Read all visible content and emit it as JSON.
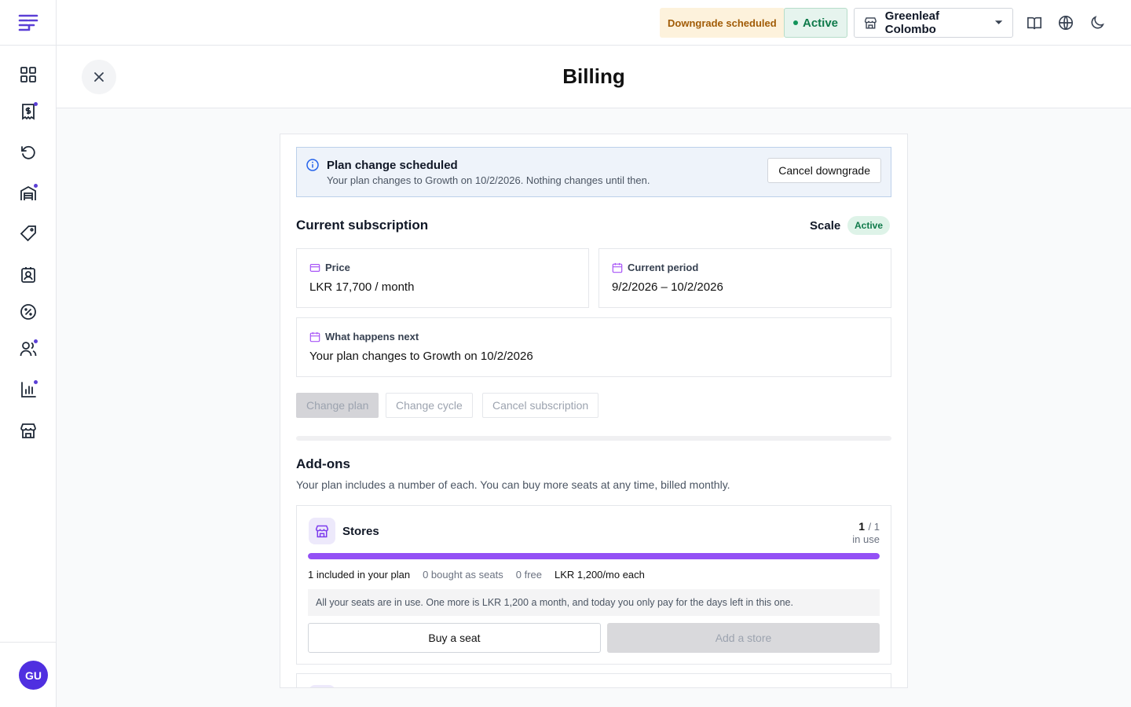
{
  "topbar": {
    "downgrade_badge": "Downgrade scheduled",
    "status_badge": "Active",
    "store_name": "Greenleaf Colombo"
  },
  "header": {
    "title": "Billing"
  },
  "notice": {
    "title": "Plan change scheduled",
    "message": "Your plan changes to Growth on 10/2/2026. Nothing changes until then.",
    "cancel_label": "Cancel downgrade"
  },
  "subscription": {
    "section_title": "Current subscription",
    "plan_name": "Scale",
    "plan_status": "Active",
    "price_label": "Price",
    "price_value": "LKR 17,700 / month",
    "period_label": "Current period",
    "period_value": "9/2/2026 – 10/2/2026",
    "next_label": "What happens next",
    "next_value": "Your plan changes to Growth on 10/2/2026",
    "actions": {
      "change_plan": "Change plan",
      "change_cycle": "Change cycle",
      "cancel_subscription": "Cancel subscription"
    }
  },
  "addons": {
    "title": "Add-ons",
    "subtitle": "Your plan includes a number of each. You can buy more seats at any time, billed monthly.",
    "items": [
      {
        "name": "Stores",
        "used": "1",
        "total": "/ 1",
        "in_use_label": "in use",
        "usage_fraction": 1.0,
        "included": "1 included in your plan",
        "bought": "0 bought as seats",
        "free": "0 free",
        "price": "LKR 1,200/mo each",
        "note": "All your seats are in use. One more is LKR 1,200 a month, and today you only pay for the days left in this one.",
        "buy_label": "Buy a seat",
        "add_label": "Add a store"
      }
    ]
  },
  "user": {
    "initials": "GU"
  },
  "colors": {
    "accent": "#9350f5",
    "brand": "#5b3fd6",
    "success": "#0f7a4a",
    "warning": "#a15c07"
  }
}
